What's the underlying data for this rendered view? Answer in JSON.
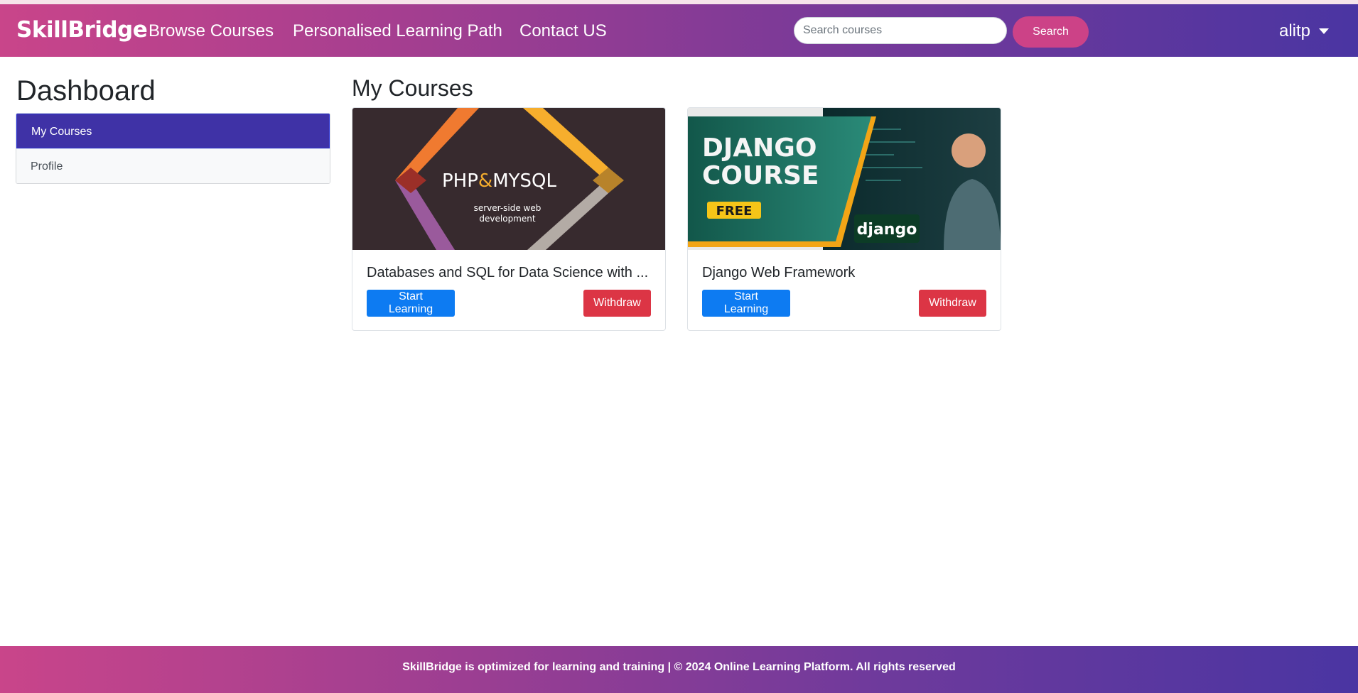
{
  "navbar": {
    "brand": "SkillBridge",
    "links": [
      "Browse Courses",
      "Personalised Learning Path",
      "Contact US"
    ],
    "search_placeholder": "Search courses",
    "search_button": "Search",
    "user": "alitp"
  },
  "sidebar": {
    "title": "Dashboard",
    "items": [
      {
        "label": "My Courses",
        "active": true
      },
      {
        "label": "Profile",
        "active": false
      }
    ]
  },
  "main": {
    "title": "My Courses",
    "courses": [
      {
        "title": "Databases and SQL for Data Science with ...",
        "image": {
          "headline_a": "PHP",
          "headline_amp": "&",
          "headline_b": "MYSQL",
          "sub1": "server-side web",
          "sub2": "development"
        },
        "start_label": "Start Learning",
        "withdraw_label": "Withdraw"
      },
      {
        "title": "Django Web Framework",
        "image": {
          "line1": "DJANGO",
          "line2": "COURSE",
          "badge": "FREE",
          "logo": "django"
        },
        "start_label": "Start Learning",
        "withdraw_label": "Withdraw"
      }
    ]
  },
  "footer": {
    "text": "SkillBridge is optimized for learning and training | © 2024 Online Learning Platform. All rights reserved"
  },
  "colors": {
    "brand_gradient_start": "#c9458a",
    "brand_gradient_end": "#4a35a2",
    "active_item": "#3f32a6",
    "primary": "#0d7bf2",
    "danger": "#dc3545"
  }
}
